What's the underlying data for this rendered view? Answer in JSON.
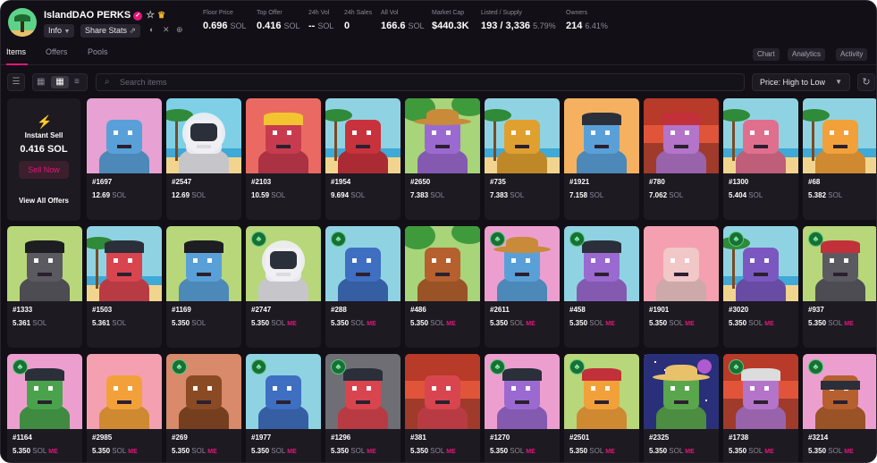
{
  "header": {
    "title": "IslandDAO PERKS",
    "info_label": "Info",
    "share_label": "Share Stats",
    "stats": [
      {
        "label": "Floor Price",
        "value": "0.696",
        "unit": "SOL"
      },
      {
        "label": "Top Offer",
        "value": "0.416",
        "unit": "SOL"
      },
      {
        "label": "24h Vol",
        "value": "--",
        "unit": "SOL"
      },
      {
        "label": "24h Sales",
        "value": "0",
        "unit": ""
      },
      {
        "label": "All Vol",
        "value": "166.6",
        "unit": "SOL"
      },
      {
        "label": "Market Cap",
        "value": "$440.3K",
        "unit": ""
      },
      {
        "label": "Listed / Supply",
        "value": "193 / 3,336",
        "unit": "5.79%"
      },
      {
        "label": "Owners",
        "value": "214",
        "unit": "6.41%"
      }
    ]
  },
  "tabs": [
    "Items",
    "Offers",
    "Pools"
  ],
  "view_buttons": [
    "Chart",
    "Analytics",
    "Activity"
  ],
  "toolbar": {
    "search_placeholder": "Search items",
    "sort_label": "Price: High to Low"
  },
  "instant_sell": {
    "title": "Instant Sell",
    "price": "0.416 SOL",
    "button": "Sell Now",
    "link": "View All Offers"
  },
  "items": [
    {
      "name": "#1697",
      "price": "12.69",
      "unit": "SOL",
      "me": false,
      "clover": false,
      "bg": "#e7a1d2",
      "fg": "#5aa0d8",
      "scene": "plain",
      "hat": "none"
    },
    {
      "name": "#2547",
      "price": "12.69",
      "unit": "SOL",
      "me": false,
      "clover": false,
      "bg": "#7fd0e6",
      "fg": "#e9e9ee",
      "scene": "beach",
      "hat": "helmet"
    },
    {
      "name": "#2103",
      "price": "10.59",
      "unit": "SOL",
      "me": false,
      "clover": false,
      "bg": "#ea6a63",
      "fg": "#c83b4f",
      "scene": "plain",
      "hat": "crown"
    },
    {
      "name": "#1954",
      "price": "9.694",
      "unit": "SOL",
      "me": false,
      "clover": false,
      "bg": "#8fd3e3",
      "fg": "#c8323c",
      "scene": "beach",
      "hat": "none"
    },
    {
      "name": "#2650",
      "price": "7.383",
      "unit": "SOL",
      "me": false,
      "clover": false,
      "bg": "#a8d47a",
      "fg": "#9b6ad0",
      "scene": "jungle",
      "hat": "cowboy"
    },
    {
      "name": "#735",
      "price": "7.383",
      "unit": "SOL",
      "me": false,
      "clover": false,
      "bg": "#8fd3e3",
      "fg": "#e0a030",
      "scene": "beach",
      "hat": "none"
    },
    {
      "name": "#1921",
      "price": "7.158",
      "unit": "SOL",
      "me": false,
      "clover": false,
      "bg": "#f5b160",
      "fg": "#5aa0d8",
      "scene": "plain",
      "hat": "cap"
    },
    {
      "name": "#780",
      "price": "7.062",
      "unit": "SOL",
      "me": false,
      "clover": false,
      "bg": "#e0553a",
      "fg": "#b374c9",
      "scene": "sunset",
      "hat": "beret"
    },
    {
      "name": "#1300",
      "price": "5.404",
      "unit": "SOL",
      "me": false,
      "clover": false,
      "bg": "#8fd3e3",
      "fg": "#e06f8e",
      "scene": "beach",
      "hat": "none"
    },
    {
      "name": "#68",
      "price": "5.382",
      "unit": "SOL",
      "me": false,
      "clover": false,
      "bg": "#8fd3e3",
      "fg": "#f2a13a",
      "scene": "beach",
      "hat": "none"
    },
    {
      "name": "#1333",
      "price": "5.361",
      "unit": "SOL",
      "me": false,
      "clover": false,
      "bg": "#b7d77a",
      "fg": "#5a5a60",
      "scene": "plain",
      "hat": "pirate"
    },
    {
      "name": "#1503",
      "price": "5.361",
      "unit": "SOL",
      "me": false,
      "clover": false,
      "bg": "#8fd3e3",
      "fg": "#d8454f",
      "scene": "beach",
      "hat": "cap"
    },
    {
      "name": "#1169",
      "price": "5.350",
      "unit": "SOL",
      "me": false,
      "clover": false,
      "bg": "#b7d77a",
      "fg": "#5aa0d8",
      "scene": "plain",
      "hat": "pirate"
    },
    {
      "name": "#2747",
      "price": "5.350",
      "unit": "SOL",
      "me": true,
      "clover": true,
      "bg": "#b7d77a",
      "fg": "#e9e9ee",
      "scene": "plain",
      "hat": "helmet"
    },
    {
      "name": "#288",
      "price": "5.350",
      "unit": "SOL",
      "me": true,
      "clover": true,
      "bg": "#8fd3e3",
      "fg": "#3e6fc0",
      "scene": "plain",
      "hat": "none"
    },
    {
      "name": "#486",
      "price": "5.350",
      "unit": "SOL",
      "me": true,
      "clover": false,
      "bg": "#a8d47a",
      "fg": "#b5602e",
      "scene": "jungle",
      "hat": "none"
    },
    {
      "name": "#2611",
      "price": "5.350",
      "unit": "SOL",
      "me": true,
      "clover": true,
      "bg": "#ec9fcf",
      "fg": "#5aa0d8",
      "scene": "plain",
      "hat": "cowboy"
    },
    {
      "name": "#458",
      "price": "5.350",
      "unit": "SOL",
      "me": true,
      "clover": true,
      "bg": "#8fd3e3",
      "fg": "#9b6ad0",
      "scene": "plain",
      "hat": "cap"
    },
    {
      "name": "#1901",
      "price": "5.350",
      "unit": "SOL",
      "me": true,
      "clover": false,
      "bg": "#f4a0b0",
      "fg": "#f2c7c7",
      "scene": "plain",
      "hat": "none"
    },
    {
      "name": "#3020",
      "price": "5.350",
      "unit": "SOL",
      "me": true,
      "clover": true,
      "bg": "#8fd3e3",
      "fg": "#7a58c0",
      "scene": "beach",
      "hat": "none"
    },
    {
      "name": "#937",
      "price": "5.350",
      "unit": "SOL",
      "me": true,
      "clover": true,
      "bg": "#b7d77a",
      "fg": "#5a5a60",
      "scene": "plain",
      "hat": "samurai"
    },
    {
      "name": "#1164",
      "price": "5.350",
      "unit": "SOL",
      "me": true,
      "clover": true,
      "bg": "#ec9fcf",
      "fg": "#4aa34c",
      "scene": "plain",
      "hat": "cap"
    },
    {
      "name": "#2985",
      "price": "5.350",
      "unit": "SOL",
      "me": true,
      "clover": false,
      "bg": "#f4a0b0",
      "fg": "#f2a13a",
      "scene": "plain",
      "hat": "none"
    },
    {
      "name": "#269",
      "price": "5.350",
      "unit": "SOL",
      "me": true,
      "clover": true,
      "bg": "#d88a6a",
      "fg": "#8a4a24",
      "scene": "plain",
      "hat": "none"
    },
    {
      "name": "#1977",
      "price": "5.350",
      "unit": "SOL",
      "me": true,
      "clover": true,
      "bg": "#8fd3e3",
      "fg": "#3e6fc0",
      "scene": "plain",
      "hat": "none"
    },
    {
      "name": "#1296",
      "price": "5.350",
      "unit": "SOL",
      "me": true,
      "clover": true,
      "bg": "#6e6e74",
      "fg": "#d8454f",
      "scene": "plain",
      "hat": "cap"
    },
    {
      "name": "#381",
      "price": "5.350",
      "unit": "SOL",
      "me": true,
      "clover": false,
      "bg": "#e0553a",
      "fg": "#d8454f",
      "scene": "sunset",
      "hat": "none"
    },
    {
      "name": "#1270",
      "price": "5.350",
      "unit": "SOL",
      "me": true,
      "clover": true,
      "bg": "#ec9fcf",
      "fg": "#9b6ad0",
      "scene": "plain",
      "hat": "cap"
    },
    {
      "name": "#2501",
      "price": "5.350",
      "unit": "SOL",
      "me": true,
      "clover": true,
      "bg": "#b7d77a",
      "fg": "#f2a13a",
      "scene": "plain",
      "hat": "spartan"
    },
    {
      "name": "#2325",
      "price": "5.350",
      "unit": "SOL",
      "me": true,
      "clover": false,
      "bg": "#2a2f7a",
      "fg": "#5aa64c",
      "scene": "space",
      "hat": "conical"
    },
    {
      "name": "#1738",
      "price": "5.350",
      "unit": "SOL",
      "me": true,
      "clover": true,
      "bg": "#e0553a",
      "fg": "#b374c9",
      "scene": "sunset",
      "hat": "viking"
    },
    {
      "name": "#3214",
      "price": "5.350",
      "unit": "SOL",
      "me": true,
      "clover": true,
      "bg": "#ec9fcf",
      "fg": "#b5602e",
      "scene": "plain",
      "hat": "goggles"
    }
  ]
}
